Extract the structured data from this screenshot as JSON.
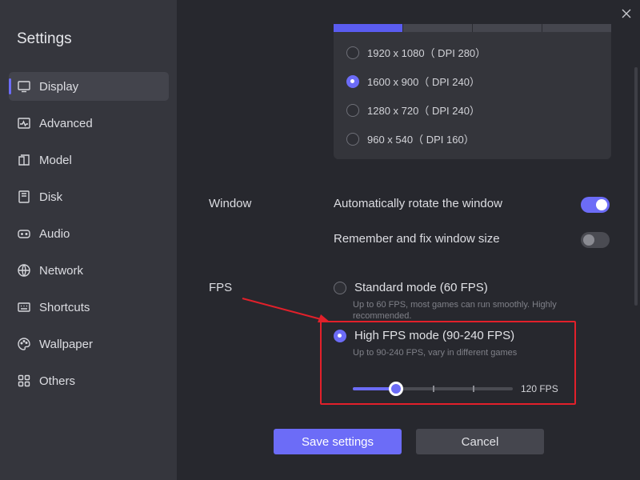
{
  "sidebar": {
    "title": "Settings",
    "items": [
      {
        "label": "Display",
        "icon": "monitor-icon",
        "active": true
      },
      {
        "label": "Advanced",
        "icon": "pulse-icon",
        "active": false
      },
      {
        "label": "Model",
        "icon": "device-icon",
        "active": false
      },
      {
        "label": "Disk",
        "icon": "disk-icon",
        "active": false
      },
      {
        "label": "Audio",
        "icon": "gamepad-icon",
        "active": false
      },
      {
        "label": "Network",
        "icon": "globe-icon",
        "active": false
      },
      {
        "label": "Shortcuts",
        "icon": "keyboard-icon",
        "active": false
      },
      {
        "label": "Wallpaper",
        "icon": "palette-icon",
        "active": false
      },
      {
        "label": "Others",
        "icon": "grid-icon",
        "active": false
      }
    ]
  },
  "resolution": {
    "options": [
      {
        "label": "1920 x 1080（ DPI 280）",
        "selected": false
      },
      {
        "label": "1600 x 900（ DPI 240）",
        "selected": true
      },
      {
        "label": "1280 x 720（ DPI 240）",
        "selected": false
      },
      {
        "label": "960 x 540（ DPI 160）",
        "selected": false
      }
    ]
  },
  "window": {
    "section_label": "Window",
    "auto_rotate_label": "Automatically rotate the window",
    "auto_rotate_on": true,
    "remember_size_label": "Remember and fix window size",
    "remember_size_on": false
  },
  "fps": {
    "section_label": "FPS",
    "standard_label": "Standard mode (60 FPS)",
    "standard_desc": "Up to 60 FPS, most games can run smoothly. Highly recommended.",
    "high_label": "High FPS mode (90-240 FPS)",
    "high_desc": "Up to 90-240 FPS, vary in different games",
    "selected": "high",
    "slider_fraction": 0.27,
    "slider_value_label": "120 FPS"
  },
  "buttons": {
    "save_label": "Save settings",
    "cancel_label": "Cancel"
  },
  "colors": {
    "accent": "#6c6cf7",
    "highlight": "#e2202a"
  }
}
